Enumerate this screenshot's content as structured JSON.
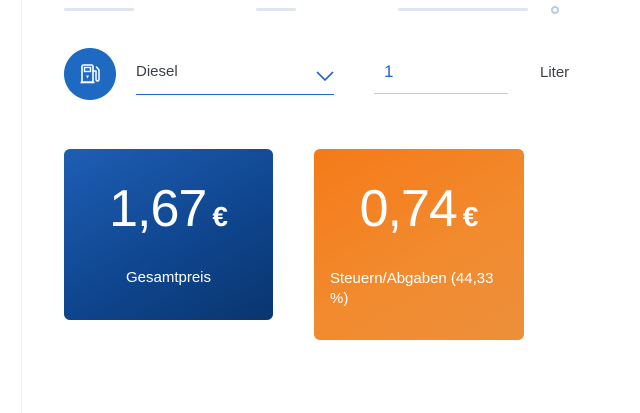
{
  "fuel_select": {
    "selected": "Diesel"
  },
  "amount": {
    "value": "1",
    "unit": "Liter"
  },
  "cards": {
    "total": {
      "amount": "1,67",
      "currency": "€",
      "label": "Gesamtpreis",
      "color": "#0f468f"
    },
    "tax": {
      "amount": "0,74",
      "currency": "€",
      "label": "Steuern/Abgaben (44,33 %)",
      "color": "#f57a18"
    }
  },
  "colors": {
    "accent": "#1e69c2"
  },
  "icons": {
    "fuel": "fuel-pump-icon",
    "dropdown": "chevron-down-icon"
  }
}
